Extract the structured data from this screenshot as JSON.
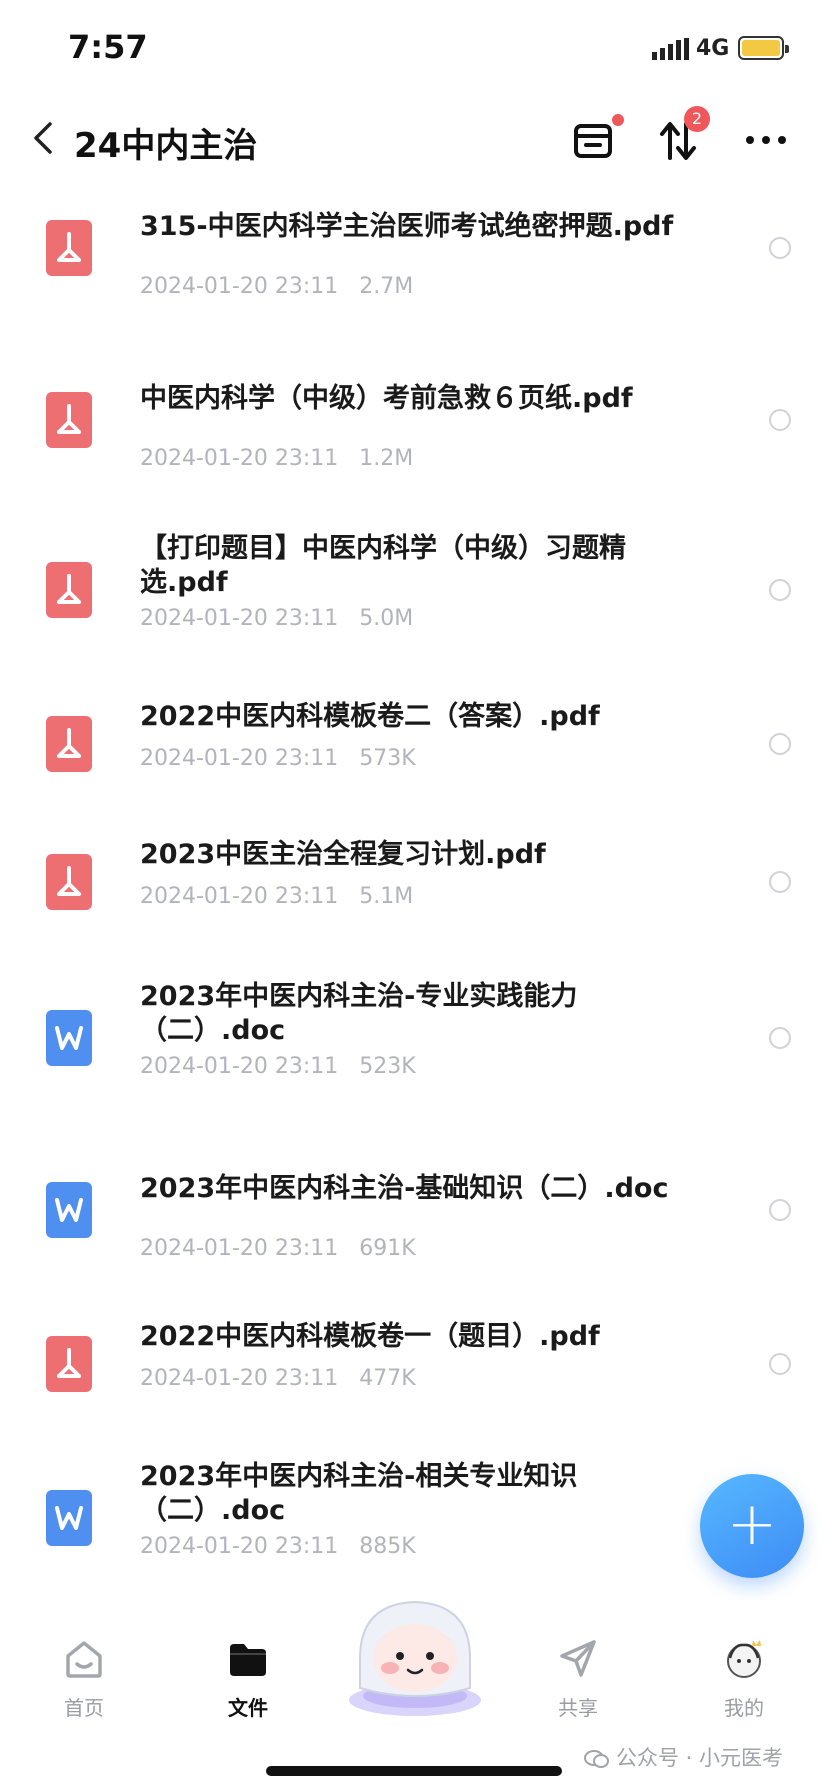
{
  "status": {
    "time": "7:57",
    "network": "4G"
  },
  "header": {
    "title": "24中内主治",
    "transfer_badge": "2"
  },
  "files": [
    {
      "type": "pdf",
      "name": "315-中医内科学主治医师考试绝密押题.pdf",
      "date": "2024-01-20 23:11",
      "size": "2.7M"
    },
    {
      "type": "pdf",
      "name": "中医内科学（中级）考前急救６页纸.pdf",
      "date": "2024-01-20 23:11",
      "size": "1.2M"
    },
    {
      "type": "pdf",
      "name": "【打印题目】中医内科学（中级）习题精选.pdf",
      "date": "2024-01-20 23:11",
      "size": "5.0M"
    },
    {
      "type": "pdf",
      "name": "2022中医内科模板卷二（答案）.pdf",
      "date": "2024-01-20 23:11",
      "size": "573K"
    },
    {
      "type": "pdf",
      "name": "2023中医主治全程复习计划.pdf",
      "date": "2024-01-20 23:11",
      "size": "5.1M"
    },
    {
      "type": "doc",
      "name": "2023年中医内科主治-专业实践能力（二）.doc",
      "date": "2024-01-20 23:11",
      "size": "523K"
    },
    {
      "type": "doc",
      "name": "2023年中医内科主治-基础知识（二）.doc",
      "date": "2024-01-20 23:11",
      "size": "691K"
    },
    {
      "type": "pdf",
      "name": "2022中医内科模板卷一（题目）.pdf",
      "date": "2024-01-20 23:11",
      "size": "477K"
    },
    {
      "type": "doc",
      "name": "2023年中医内科主治-相关专业知识（二）.doc",
      "date": "2024-01-20 23:11",
      "size": "885K"
    }
  ],
  "fab": {
    "label": "+"
  },
  "tabs": [
    {
      "label": "首页",
      "icon": "home-icon"
    },
    {
      "label": "文件",
      "icon": "folder-icon"
    },
    {
      "label": "共享",
      "icon": "share-icon"
    },
    {
      "label": "我的",
      "icon": "profile-avatar-icon"
    }
  ],
  "watermark": "公众号 · 小元医考",
  "colors": {
    "pdf": "#ee6f72",
    "doc": "#4f8ff0",
    "accent": "#3d8cf5",
    "badge": "#f0575b"
  }
}
